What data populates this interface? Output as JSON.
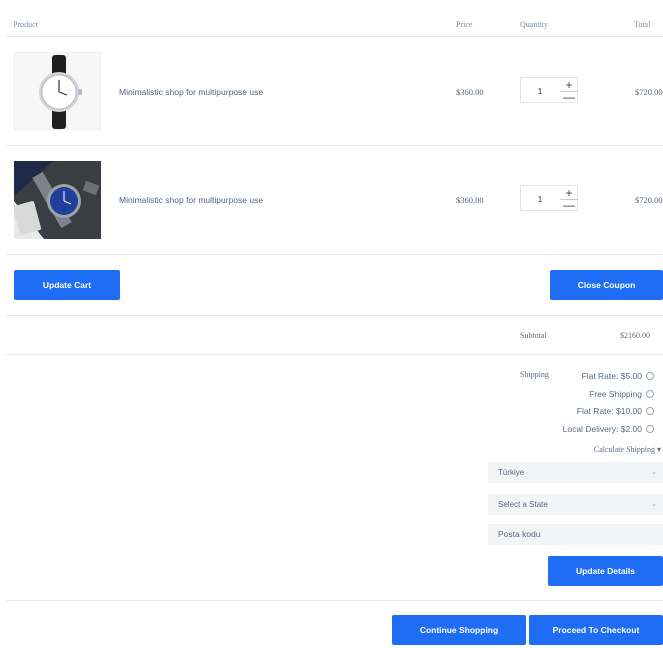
{
  "header": {
    "product": "Product",
    "price": "Price",
    "quantity": "Quantity",
    "total": "Total"
  },
  "items": [
    {
      "name": "Minimalistic shop for multipurpose use",
      "price": "$360.00",
      "quantity": "1",
      "total": "$720.00",
      "image": "white-dial-watch-image"
    },
    {
      "name": "Minimalistic shop for multipurpose use",
      "price": "$360.00",
      "quantity": "1",
      "total": "$720.00",
      "image": "blue-dial-watch-image"
    }
  ],
  "qty_controls": {
    "plus": "+",
    "minus": "—"
  },
  "actions": {
    "update_cart": "Update Cart",
    "close_coupon": "Close Coupon",
    "update_details": "Update Details",
    "continue_shopping": "Continue Shopping",
    "proceed_checkout": "Proceed To Checkout"
  },
  "totals": {
    "subtotal_label": "Subtotal",
    "subtotal_value": "$2160.00",
    "shipping_label": "Shipping",
    "shipping_options": [
      "Flat Rate: $5.00",
      "Free Shipping",
      "Flat Rate: $10.00",
      "Local Delivery: $2.00"
    ],
    "calculate_shipping": "Calculate Shipping",
    "calculate_arrow": "▾",
    "country_value": "Türkiye",
    "state_value": "Select a State",
    "postcode_placeholder": "Posta kodu",
    "select_chevron": "⌄"
  },
  "colors": {
    "accent": "#1f6cf5",
    "divider": "#e6e9ee"
  }
}
